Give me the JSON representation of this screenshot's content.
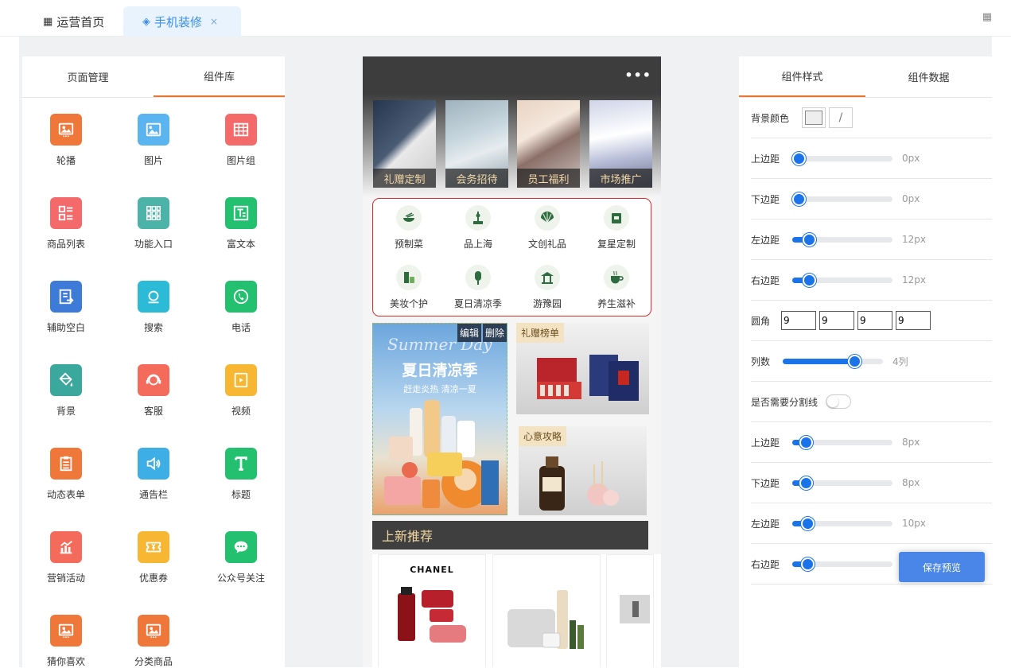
{
  "tabs": {
    "home_label": "运营首页",
    "active_label": "手机装修",
    "close_glyph": "×"
  },
  "left_panel": {
    "tabs": [
      "页面管理",
      "组件库"
    ],
    "components": [
      {
        "label": "轮播",
        "icon": "image-icon",
        "color": "#f0773a"
      },
      {
        "label": "图片",
        "icon": "picture-icon",
        "color": "#5ab4f0"
      },
      {
        "label": "图片组",
        "icon": "grid-table-icon",
        "color": "#f46a6a"
      },
      {
        "label": "商品列表",
        "icon": "list-icon",
        "color": "#f46a6a"
      },
      {
        "label": "功能入口",
        "icon": "apps-grid-icon",
        "color": "#4bb3a8"
      },
      {
        "label": "富文本",
        "icon": "rich-text-icon",
        "color": "#23c06f"
      },
      {
        "label": "辅助空白",
        "icon": "blank-icon",
        "color": "#3e7ad8"
      },
      {
        "label": "搜索",
        "icon": "search-icon",
        "color": "#2bbbd6"
      },
      {
        "label": "电话",
        "icon": "phone-icon",
        "color": "#23c06f"
      },
      {
        "label": "背景",
        "icon": "paint-bucket-icon",
        "color": "#3aa89d"
      },
      {
        "label": "客服",
        "icon": "headset-icon",
        "color": "#f46a5b"
      },
      {
        "label": "视频",
        "icon": "video-icon",
        "color": "#f7b733"
      },
      {
        "label": "动态表单",
        "icon": "form-icon",
        "color": "#f0773a"
      },
      {
        "label": "通告栏",
        "icon": "speaker-icon",
        "color": "#3eaee6"
      },
      {
        "label": "标题",
        "icon": "title-icon",
        "color": "#23c06f"
      },
      {
        "label": "营销活动",
        "icon": "chart-up-icon",
        "color": "#f46a5b"
      },
      {
        "label": "优惠券",
        "icon": "coupon-icon",
        "color": "#f7b733"
      },
      {
        "label": "公众号关注",
        "icon": "wechat-icon",
        "color": "#23c06f"
      },
      {
        "label": "猜你喜欢",
        "icon": "image-icon",
        "color": "#f0773a"
      },
      {
        "label": "分类商品",
        "icon": "image-icon",
        "color": "#f0773a"
      }
    ]
  },
  "phone": {
    "menu_dots": "•••",
    "categories": [
      "礼赠定制",
      "会务招待",
      "员工福利",
      "市场推广"
    ],
    "functions": [
      "预制菜",
      "品上海",
      "文创礼品",
      "复星定制",
      "美妆个护",
      "夏日清凉季",
      "游豫园",
      "养生滋补"
    ],
    "promo_main": {
      "script_text": "Summer Day",
      "title": "夏日清凉季",
      "subtitle": "赶走炎热 清凉一夏",
      "edit_label": "编辑",
      "delete_label": "删除"
    },
    "promo_cards": [
      "礼赠榜单",
      "心意攻略"
    ],
    "new_section_title": "上新推荐",
    "brand_text": "CHANEL"
  },
  "right_panel": {
    "tabs": [
      "组件样式",
      "组件数据"
    ],
    "bg_color_label": "背景颜色",
    "no_color_glyph": "/",
    "sliders_top": [
      {
        "label": "上边距",
        "value": "0px",
        "level": 0
      },
      {
        "label": "下边距",
        "value": "0px",
        "level": 0
      },
      {
        "label": "左边距",
        "value": "12px",
        "level": 0.12
      },
      {
        "label": "右边距",
        "value": "12px",
        "level": 0.12
      }
    ],
    "radius_label": "圆角",
    "radius_values": [
      "9",
      "9",
      "9",
      "9"
    ],
    "columns_label": "列数",
    "columns_value": "4列",
    "columns_level": 0.75,
    "divider_label": "是否需要分割线",
    "sliders_bottom": [
      {
        "label": "上边距",
        "value": "8px",
        "level": 0.08
      },
      {
        "label": "下边距",
        "value": "8px",
        "level": 0.08
      },
      {
        "label": "左边距",
        "value": "10px",
        "level": 0.1
      },
      {
        "label": "右边距",
        "value": "",
        "level": 0.1
      }
    ],
    "save_label": "保存预览"
  }
}
